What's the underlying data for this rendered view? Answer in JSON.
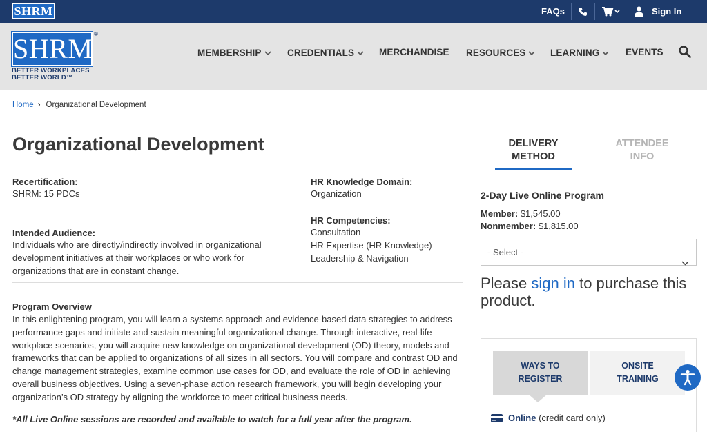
{
  "topbar": {
    "logo": "SHRM",
    "faqs": "FAQs",
    "sign_in": "Sign In",
    "icons": [
      "phone-icon",
      "cart-icon",
      "user-icon"
    ]
  },
  "header": {
    "logo": "SHRM",
    "tagline_1": "BETTER WORKPLACES",
    "tagline_2": "BETTER WORLD™",
    "nav": [
      {
        "label": "MEMBERSHIP",
        "dropdown": true
      },
      {
        "label": "CREDENTIALS",
        "dropdown": true
      },
      {
        "label": "MERCHANDISE",
        "dropdown": false
      },
      {
        "label": "RESOURCES",
        "dropdown": true
      },
      {
        "label": "LEARNING",
        "dropdown": true
      },
      {
        "label": "EVENTS",
        "dropdown": false
      }
    ]
  },
  "breadcrumb": {
    "home": "Home",
    "current": "Organizational Development"
  },
  "page": {
    "title": "Organizational Development",
    "recert_label": "Recertification:",
    "recert_value": "SHRM: 15 PDCs",
    "audience_label": "Intended Audience:",
    "audience_value": "Individuals who are directly/indirectly involved in organizational development initiatives at their workplaces or who work for organizations that are in constant change.",
    "domain_label": "HR Knowledge Domain:",
    "domain_value": "Organization",
    "competencies_label": "HR Competencies:",
    "competencies": [
      "Consultation",
      "HR Expertise (HR Knowledge)",
      "Leadership & Navigation"
    ],
    "overview_label": "Program Overview",
    "overview_text": "In this enlightening program, you will learn a systems approach and evidence-based data strategies to address performance gaps and initiate and sustain meaningful organizational change. Through interactive, real-life workplace scenarios, you will acquire new knowledge on organizational development (OD) theory, models and frameworks that can be applied to organizations of all sizes in all sectors. You will compare and contrast OD and change management strategies, examine common use cases for OD, and evaluate the role of OD in achieving overall business objectives. Using a seven-phase action research framework, you will begin developing your organization’s OD strategy by aligning the workforce to meet critical business needs.",
    "note": "*All Live Online sessions are recorded and available to watch for a full year after the program."
  },
  "sidebar": {
    "tab_delivery": "DELIVERY METHOD",
    "tab_attendee": "ATTENDEE INFO",
    "program_title": "2-Day Live Online Program",
    "member_label": "Member:",
    "member_price": "$1,545.00",
    "nonmember_label": "Nonmember:",
    "nonmember_price": "$1,815.00",
    "select_value": "- Select -",
    "please_1": "Please ",
    "sign_in_link": "sign in",
    "please_2": " to purchase this product.",
    "ways_tab": "WAYS TO REGISTER",
    "onsite_tab": "ONSITE TRAINING",
    "online_label": "Online",
    "online_note": "(credit card only)"
  },
  "colors": {
    "navy": "#1d3a6b",
    "blue": "#1f69c4",
    "header_gray": "#e4e4e4"
  }
}
